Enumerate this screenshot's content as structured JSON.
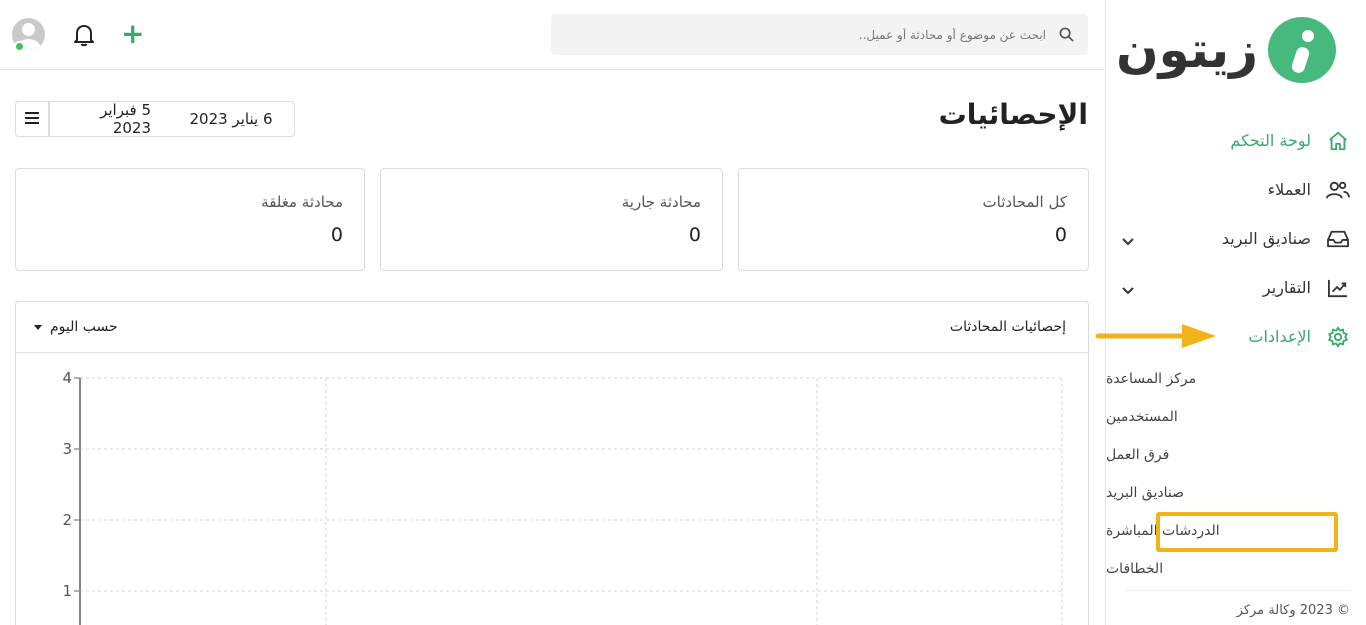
{
  "brand": {
    "name": "زيتون",
    "accent": "#48b97c",
    "highlight": "#f2b21c"
  },
  "search": {
    "placeholder": "ابحث عن موضوع أو محادثة أو عميل.."
  },
  "sidebar": {
    "items": [
      {
        "label": "لوحة التحكم",
        "icon": "home-icon",
        "active": true
      },
      {
        "label": "العملاء",
        "icon": "users-icon"
      },
      {
        "label": "صناديق البريد",
        "icon": "inbox-icon",
        "has_children": true
      },
      {
        "label": "التقارير",
        "icon": "chart-line-icon",
        "has_children": true
      },
      {
        "label": "الإعدادات",
        "icon": "gear-icon",
        "active": true
      }
    ],
    "settings_sub": [
      {
        "label": "مركز المساعدة"
      },
      {
        "label": "المستخدمين"
      },
      {
        "label": "فرق العمل"
      },
      {
        "label": "صناديق البريد"
      },
      {
        "label": "الدردشات المباشرة",
        "highlighted": true
      },
      {
        "label": "الخطافات"
      }
    ],
    "copyright": "© 2023 وكالة مركز"
  },
  "header": {
    "title": "الإحصائيات",
    "date_from": "6 يناير 2023",
    "date_to": "5 فبراير 2023"
  },
  "stats": [
    {
      "label": "كل المحادثات",
      "value": "0"
    },
    {
      "label": "محادثة جارية",
      "value": "0"
    },
    {
      "label": "محادثة مغلقة",
      "value": "0"
    }
  ],
  "chart_panel": {
    "title": "إحصائيات المحادثات",
    "group_by": "حسب اليوم"
  },
  "chart_data": {
    "type": "line",
    "title": "إحصائيات المحادثات",
    "x": [],
    "series": [],
    "yticks": [
      "1",
      "2",
      "3",
      "4"
    ],
    "ylim": [
      0,
      4
    ],
    "grid": true
  }
}
